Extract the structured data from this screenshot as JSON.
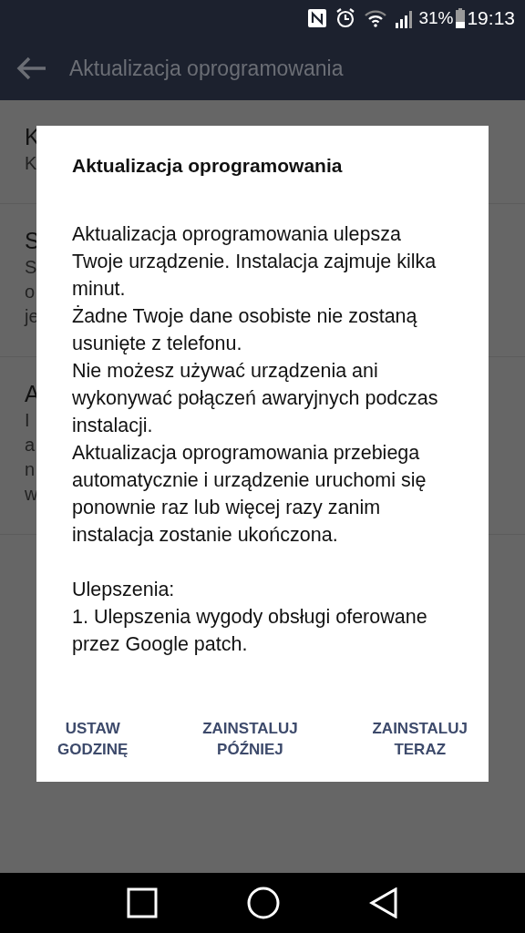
{
  "status_bar": {
    "battery": "31%",
    "time": "19:13"
  },
  "app_bar": {
    "title": "Aktualizacja oprogramowania"
  },
  "list_items": [
    {
      "title": "K",
      "lines": [
        "K"
      ]
    },
    {
      "title": "S",
      "lines": [
        "S",
        "o",
        "je"
      ]
    },
    {
      "title": "A",
      "lines": [
        "I",
        "a",
        "n",
        "w"
      ]
    }
  ],
  "dialog": {
    "title": "Aktualizacja oprogramowania",
    "paragraphs": [
      "Aktualizacja oprogramowania ulepsza Twoje urządzenie. Instalacja zajmuje kilka minut.",
      "Żadne Twoje dane osobiste nie zostaną usunięte z telefonu.",
      "Nie możesz używać urządzenia ani wykonywać połączeń awaryjnych podczas instalacji.",
      "Aktualizacja oprogramowania przebiega automatycznie i urządzenie uruchomi się ponownie raz lub więcej razy zanim instalacja zostanie ukończona."
    ],
    "improvements_title": "Ulepszenia:",
    "improvements": [
      "1. Ulepszenia wygody obsługi oferowane przez Google patch."
    ],
    "buttons": [
      "USTAW\nGODZINĘ",
      "ZAINSTALUJ\nPÓŹNIEJ",
      "ZAINSTALUJ\nTERAZ"
    ]
  }
}
